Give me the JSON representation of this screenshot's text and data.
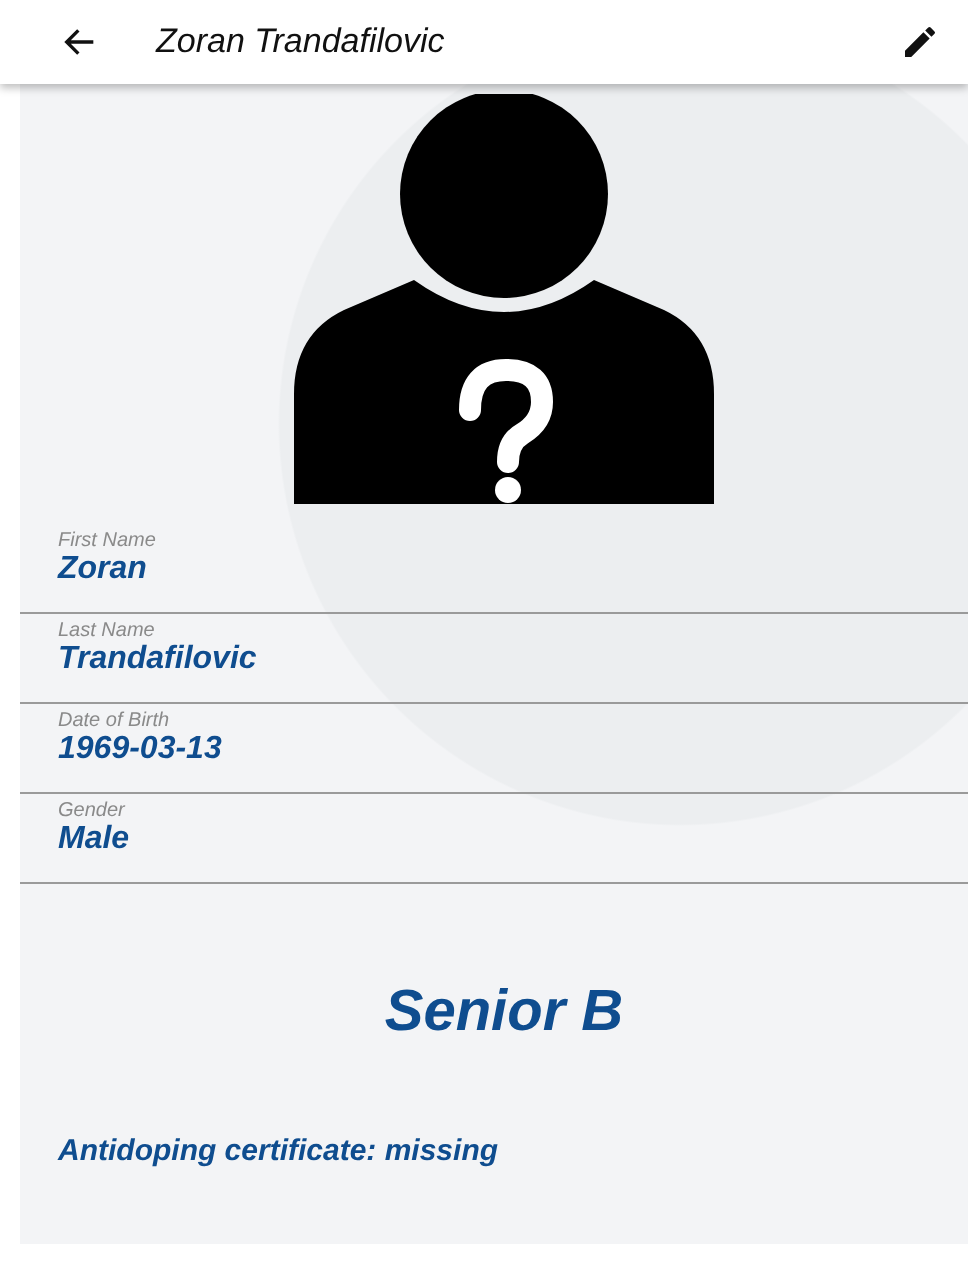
{
  "app_bar": {
    "title": "Zoran Trandafilovic"
  },
  "fields": [
    {
      "label": "First Name",
      "value": "Zoran"
    },
    {
      "label": "Last Name",
      "value": "Trandafilovic"
    },
    {
      "label": "Date of Birth",
      "value": "1969-03-13"
    },
    {
      "label": "Gender",
      "value": "Male"
    }
  ],
  "category": "Senior B",
  "certificate_status": "Antidoping certificate: missing"
}
